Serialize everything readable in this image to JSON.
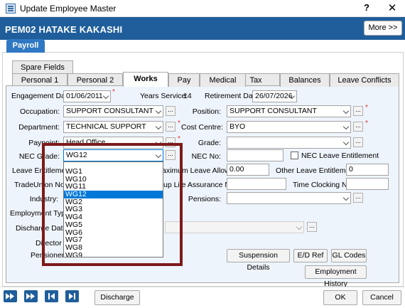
{
  "window": {
    "title": "Update Employee Master",
    "help": "?",
    "close": "✕"
  },
  "header": {
    "employee": "PEM02 HATAKE KAKASHI",
    "more_button": "More >>"
  },
  "top_tab": "Payroll",
  "tabs_row1": [
    "Spare Fields"
  ],
  "tabs_row2": [
    "Personal 1",
    "Personal 2",
    "Works",
    "Pay",
    "Medical",
    "Tax",
    "Balances",
    "Leave Conflicts"
  ],
  "selected_tab": "Works",
  "form": {
    "engagement_date_label": "Engagement Date:",
    "engagement_date": "01/06/2011",
    "years_service_label": "Years Service:",
    "years_service": "14",
    "retirement_date_label": "Retirement Date:",
    "retirement_date": "26/07/2026",
    "occupation_label": "Occupation:",
    "occupation": "SUPPORT CONSULTANT",
    "position_label": "Position:",
    "position": "SUPPORT CONSULTANT",
    "department_label": "Department:",
    "department": "TECHNICAL SUPPORT",
    "cost_centre_label": "Cost Centre:",
    "cost_centre": "BYO",
    "paypoint_label": "Paypoint:",
    "paypoint": "Head Office",
    "grade_label": "Grade:",
    "grade": "",
    "nec_grade_label": "NEC Grade:",
    "nec_grade": "WG12",
    "nec_no_label": "NEC No:",
    "nec_no": "",
    "nec_leave_label": "NEC Leave Entitlement",
    "leave_entitlement_label": "Leave Entitlement",
    "max_leave_label": "aximum Leave Allowed:",
    "max_leave": "0.00",
    "other_leave_label": "Other Leave Entitlement:",
    "other_leave": "0",
    "trade_union_label": "TradeUnion No.:",
    "life_assurance_label": "up Life Assurance No.",
    "time_clocking_label": "Time Clocking No.:",
    "industry_label": "Industry:",
    "pensions_label": "Pensions:",
    "employment_type_label": "Employment Type:",
    "discharge_date_label": "Discharge Date:",
    "director_label": "Director",
    "pensioner_label": "Pensioner"
  },
  "nec_grade_options": [
    "WG1",
    "WG10",
    "WG11",
    "WG12",
    "WG2",
    "WG3",
    "WG4",
    "WG5",
    "WG6",
    "WG7",
    "WG8",
    "WG9"
  ],
  "nec_grade_selected_index": 3,
  "buttons": {
    "suspension": "Suspension Details",
    "ed_ref": "E/D Ref",
    "gl_codes": "GL Codes",
    "employment_history": "Employment History"
  },
  "footer": {
    "discharge": "Discharge",
    "ok": "OK",
    "cancel": "Cancel"
  },
  "dots": "...",
  "colors": {
    "header": "#1f5e9a",
    "highlight": "#7d1a1a",
    "selection": "#0078d7"
  }
}
